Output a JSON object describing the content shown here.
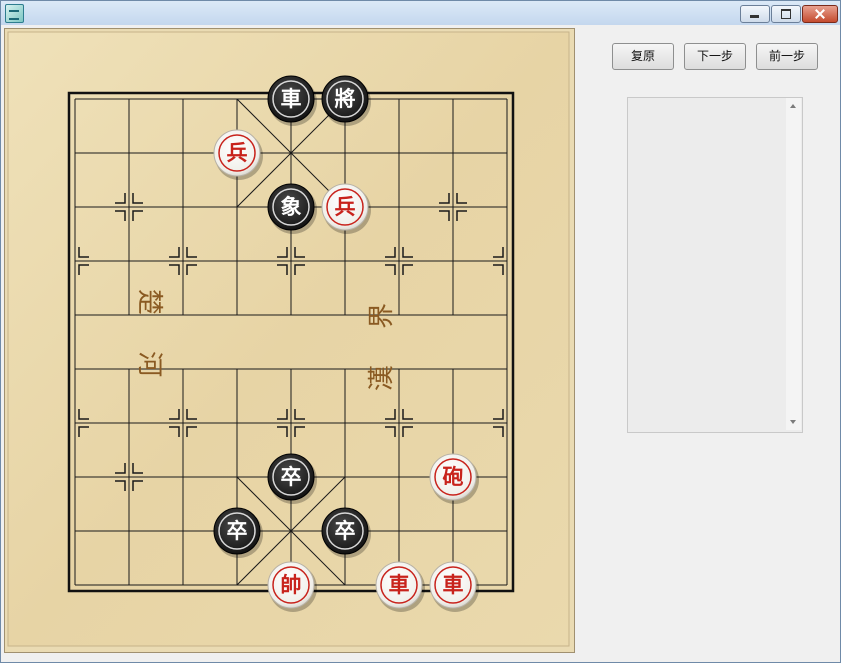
{
  "window": {
    "title": "",
    "icon": "xiangqi-app-icon"
  },
  "toolbar": {
    "restore_label": "复原",
    "next_label": "下一步",
    "prev_label": "前一步"
  },
  "board": {
    "river_left": "楚 河",
    "river_right": "漢 界",
    "colors": {
      "board_light": "#ecdcb2",
      "line": "#1a1a1a",
      "red_text": "#c8231c",
      "black_piece": "#1b1b1b"
    },
    "pieces": [
      {
        "side": "black",
        "label": "車",
        "file": 4,
        "rank": 0
      },
      {
        "side": "black",
        "label": "將",
        "file": 5,
        "rank": 0
      },
      {
        "side": "red",
        "label": "兵",
        "file": 3,
        "rank": 1
      },
      {
        "side": "black",
        "label": "象",
        "file": 4,
        "rank": 2
      },
      {
        "side": "red",
        "label": "兵",
        "file": 5,
        "rank": 2
      },
      {
        "side": "black",
        "label": "卒",
        "file": 4,
        "rank": 7
      },
      {
        "side": "red",
        "label": "砲",
        "file": 7,
        "rank": 7
      },
      {
        "side": "black",
        "label": "卒",
        "file": 3,
        "rank": 8
      },
      {
        "side": "black",
        "label": "卒",
        "file": 5,
        "rank": 8
      },
      {
        "side": "red",
        "label": "帥",
        "file": 4,
        "rank": 9
      },
      {
        "side": "red",
        "label": "車",
        "file": 6,
        "rank": 9
      },
      {
        "side": "red",
        "label": "車",
        "file": 7,
        "rank": 9
      }
    ]
  },
  "move_list": {
    "items": []
  }
}
